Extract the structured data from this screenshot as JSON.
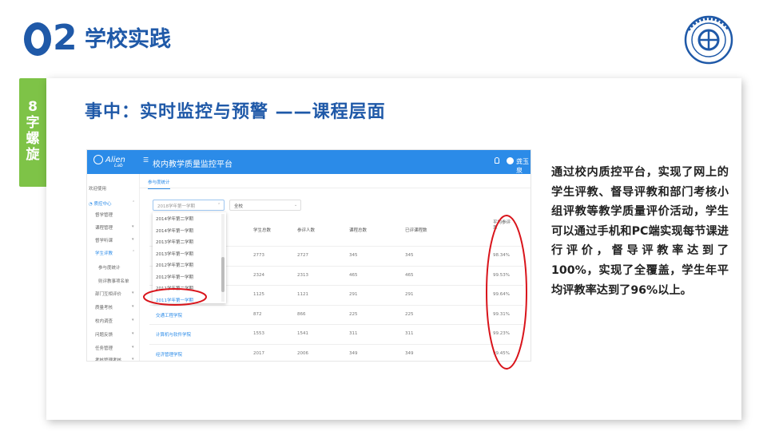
{
  "header": {
    "section_number": "02",
    "section_title": "学校实践",
    "logo_icon": "school-seal-icon"
  },
  "side_tab": {
    "text": "8字螺旋"
  },
  "card": {
    "title": "事中：实时监控与预警 ——课程层面",
    "description": "通过校内质控平台，实现了网上的学生评教、督导评教和部门考核小组评教等教学质量评价活动，学生可以通过手机和PC端实现每节课进行评价，督导评教率达到了100%，实现了全覆盖，学生年平均评教率达到了96%以上。"
  },
  "screenshot": {
    "app_title": "校内教学质量监控平台",
    "user_name": "龚玉泉",
    "sidebar": [
      {
        "label": "欢迎使用",
        "active": false,
        "caret": ""
      },
      {
        "label": "◔ 质控中心",
        "active": true,
        "caret": "⌃"
      },
      {
        "label": "督学管理",
        "active": false,
        "caret": ""
      },
      {
        "label": "课程管理",
        "active": false,
        "caret": "▾"
      },
      {
        "label": "督学听课",
        "active": false,
        "caret": "▾"
      },
      {
        "label": "学生评教",
        "active": true,
        "caret": "⌃"
      },
      {
        "label": "参与度统计",
        "active": false,
        "caret": ""
      },
      {
        "label": "则评教事项名单",
        "active": false,
        "caret": ""
      },
      {
        "label": "部门互相评价",
        "active": false,
        "caret": "▾"
      },
      {
        "label": "质量考核",
        "active": false,
        "caret": "▾"
      },
      {
        "label": "校内调查",
        "active": false,
        "caret": "▾"
      },
      {
        "label": "问题反馈",
        "active": false,
        "caret": "▾"
      },
      {
        "label": "任务管理",
        "active": false,
        "caret": "▾"
      },
      {
        "label": "考核管理考核",
        "active": false,
        "caret": "▾"
      }
    ],
    "tab": "参与度统计",
    "term_select_placeholder": "2018学年第一学期",
    "college_select_value": "全校",
    "term_options": [
      {
        "label": "2014学年第二学期",
        "selected": false
      },
      {
        "label": "2014学年第一学期",
        "selected": false
      },
      {
        "label": "2013学年第二学期",
        "selected": false
      },
      {
        "label": "2013学年第一学期",
        "selected": false
      },
      {
        "label": "2012学年第二学期",
        "selected": false
      },
      {
        "label": "2012学年第一学期",
        "selected": false
      },
      {
        "label": "2011学年第二学期",
        "selected": false
      },
      {
        "label": "2011学年第一学期",
        "selected": true
      }
    ],
    "table_headers": [
      "学生总数",
      "参评人数",
      "课程总数",
      "已评课程数",
      "平均参评率"
    ],
    "rows": [
      {
        "college": "",
        "students": "2773",
        "participants": "2727",
        "courses": "345",
        "evaluated": "345",
        "rate": "98.34%"
      },
      {
        "college": "",
        "students": "2324",
        "participants": "2313",
        "courses": "465",
        "evaluated": "465",
        "rate": "99.53%"
      },
      {
        "college": "",
        "students": "1125",
        "participants": "1121",
        "courses": "291",
        "evaluated": "291",
        "rate": "99.64%"
      },
      {
        "college": "交通工程学院",
        "students": "872",
        "participants": "866",
        "courses": "225",
        "evaluated": "225",
        "rate": "99.31%"
      },
      {
        "college": "计算机与软件学院",
        "students": "1553",
        "participants": "1541",
        "courses": "311",
        "evaluated": "311",
        "rate": "99.23%"
      },
      {
        "college": "经济管理学院",
        "students": "2017",
        "participants": "2006",
        "courses": "349",
        "evaluated": "349",
        "rate": "99.45%"
      }
    ]
  },
  "colors": {
    "brand_blue": "#1f59a8",
    "accent_green": "#7ec347",
    "app_blue": "#2b8be8",
    "annotation_red": "#d9141b"
  }
}
